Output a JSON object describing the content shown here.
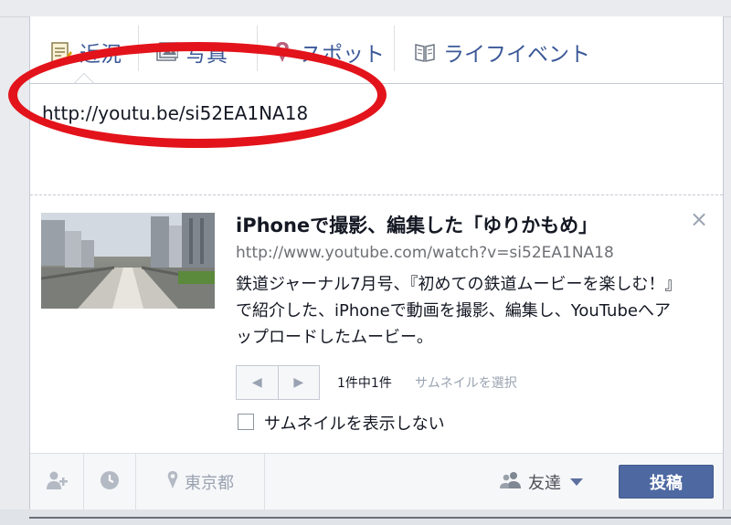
{
  "tabs": [
    {
      "label": "近況",
      "icon": "status-icon"
    },
    {
      "label": "写真",
      "icon": "photo-icon"
    },
    {
      "label": "スポット",
      "icon": "map-pin-icon"
    },
    {
      "label": "ライフイベント",
      "icon": "book-icon"
    }
  ],
  "composer": {
    "input_value": "http://youtu.be/si52EA1NA18"
  },
  "link_preview": {
    "title": "iPhoneで撮影、編集した「ゆりかもめ」",
    "url": "http://www.youtube.com/watch?v=si52EA1NA18",
    "description": "鉄道ジャーナル7月号、『初めての鉄道ムービーを楽しむ！』で紹介した、iPhoneで動画を撮影、編集し、YouTubeへアップロードしたムービー。",
    "close_glyph": "×",
    "pager_prev": "◀",
    "pager_next": "▶",
    "thumb_count": "1件中1件",
    "choose_thumbnail": "サムネイルを選択",
    "hide_thumbnail_label": "サムネイルを表示しない"
  },
  "footer": {
    "location": "東京都",
    "audience": "友達",
    "post_label": "投稿"
  },
  "colors": {
    "link_blue": "#3b5998",
    "post_button": "#4e69a2",
    "highlight_circle": "#e3131b"
  }
}
